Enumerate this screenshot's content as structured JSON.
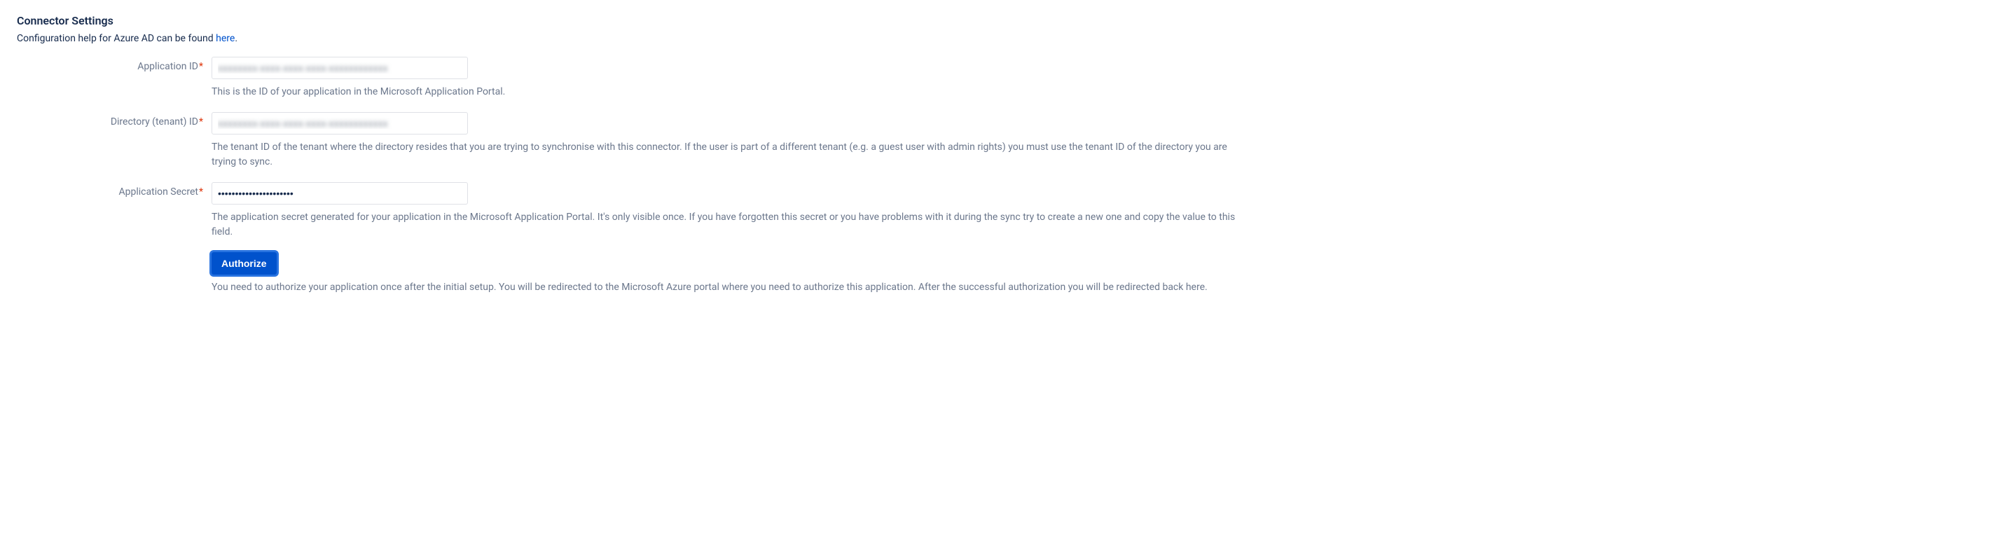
{
  "section": {
    "title": "Connector Settings",
    "help_prefix": "Configuration help for Azure AD can be found ",
    "help_link_text": "here",
    "help_suffix": "."
  },
  "fields": {
    "application_id": {
      "label": "Application ID",
      "value": "xxxxxxxx-xxxx-xxxx-xxxx-xxxxxxxxxxxx",
      "description": "This is the ID of your application in the Microsoft Application Portal."
    },
    "tenant_id": {
      "label": "Directory (tenant) ID",
      "value": "xxxxxxxx-xxxx-xxxx-xxxx-xxxxxxxxxxxx",
      "description": "The tenant ID of the tenant where the directory resides that you are trying to synchronise with this connector. If the user is part of a different tenant (e.g. a guest user with admin rights) you must use the tenant ID of the directory you are trying to sync."
    },
    "application_secret": {
      "label": "Application Secret",
      "value": "••••••••••••••••••••••",
      "description": "The application secret generated for your application in the Microsoft Application Portal. It's only visible once. If you have forgotten this secret or you have problems with it during the sync try to create a new one and copy the value to this field."
    }
  },
  "authorize": {
    "button_label": "Authorize",
    "description": "You need to authorize your application once after the initial setup. You will be redirected to the Microsoft Azure portal where you need to authorize this application. After the successful authorization you will be redirected back here."
  }
}
